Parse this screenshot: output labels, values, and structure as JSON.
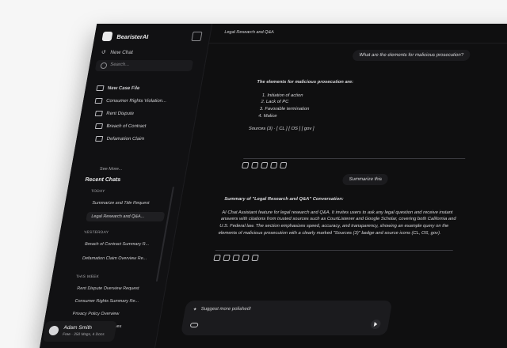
{
  "app": {
    "name": "BearisterAI"
  },
  "sidebar": {
    "new_chat": "New Chat",
    "search_placeholder": "Search...",
    "new_case_file": "New Case File",
    "case_files": [
      "Consumer Rights Violation...",
      "Rent Dispute",
      "Breach of Contract",
      "Defamation Claim"
    ],
    "see_more": "See More...",
    "recent_chats_title": "Recent Chats",
    "groups": [
      {
        "title": "TODAY",
        "items": [
          "Summarize and Title Request",
          "Legal Research and Q&A..."
        ]
      },
      {
        "title": "YESTERDAY",
        "items": [
          "Breach of Contract Summary R...",
          "Defamation Claim Overview Re..."
        ]
      },
      {
        "title": "THIS WEEK",
        "items": [
          "Rent Dispute Overview Request",
          "Consumer Rights Summary Re...",
          "Privacy Policy Overview",
          "Product Return Guidelines"
        ]
      }
    ],
    "profile": {
      "name": "Adam Smith",
      "plan": "Free · 250 Msgs, 4 Docs"
    }
  },
  "main": {
    "title": "Legal Research and Q&A",
    "messages": {
      "q1": "What are the elements for malicious prosecution?",
      "a1_heading": "The elements for malicious prosecution are:",
      "a1_list": [
        "Initiation of action",
        "Lack of PC",
        "Favorable termination",
        "Malice"
      ],
      "a1_sources": "Sources (3) · [ CL ] [ OS ] [ gov ]",
      "q2": "Summarize this",
      "a2_heading": "Summary of \"Legal Research and Q&A\" Conversation:",
      "a2_body": "AI Chat Assistant feature for legal research and Q&A. It invites users to ask any legal question and receive instant answers with citations from trusted sources such as CourtListener and Google Scholar, covering both California and U.S. Federal law. The section emphasizes speed, accuracy, and transparency, showing an example query on the elements of malicious prosecution with a clearly marked \"Sources (3)\" badge and source icons (CL, OS, gov)."
    },
    "composer": {
      "placeholder": "Suggest more polished!"
    }
  }
}
